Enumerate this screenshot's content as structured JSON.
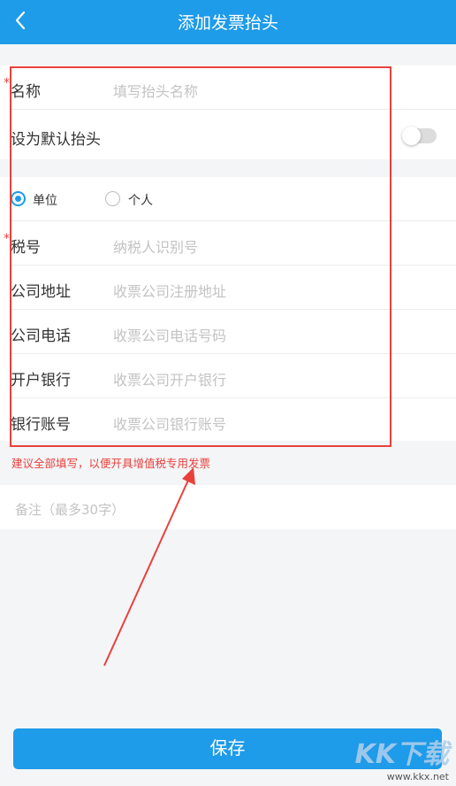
{
  "header": {
    "title": "添加发票抬头",
    "back_icon": "chevron-left-icon"
  },
  "section1": {
    "name_label": "名称",
    "name_placeholder": "填写抬头名称",
    "required_mark": "*",
    "default_label": "设为默认抬头",
    "default_on": false
  },
  "section2": {
    "type_options": [
      "单位",
      "个人"
    ],
    "selected_type": "单位",
    "tax_label": "税号",
    "tax_placeholder": "纳税人识别号",
    "address_label": "公司地址",
    "address_placeholder": "收票公司注册地址",
    "phone_label": "公司电话",
    "phone_placeholder": "收票公司电话号码",
    "bank_label": "开户银行",
    "bank_placeholder": "收票公司开户银行",
    "account_label": "银行账号",
    "account_placeholder": "收票公司银行账号"
  },
  "hint": "建议全部填写，以便开具增值税专用发票",
  "remark_placeholder": "备注（最多30字）",
  "save_label": "保存",
  "watermark": {
    "main": "KK下载",
    "sub": "www.kkx.net"
  },
  "colors": {
    "brand": "#1e9be9",
    "annotation": "#e8413c"
  }
}
